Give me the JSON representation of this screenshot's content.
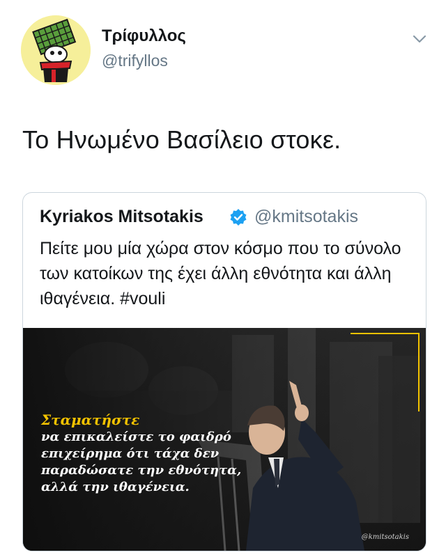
{
  "tweet": {
    "author": {
      "display_name": "Τρίφυλλος",
      "handle": "@trifyllos",
      "avatar_icon": "cartoon-character-avatar-icon"
    },
    "menu_icon": "chevron-down-icon",
    "text": "Το Ηνωμένο Βασίλειο στοκε."
  },
  "quoted_tweet": {
    "author": {
      "display_name": "Kyriakos Mitsotakis",
      "handle": "@kmitsotakis",
      "verified_icon": "verified-badge-icon"
    },
    "text": "Πείτε μου μία χώρα στον κόσμο που το σύνολο των κατοίκων της έχει άλλη εθνότητα και άλλη ιθαγένεια. #vouli",
    "media": {
      "headline": "Σταματήστε",
      "caption": "να επικαλείστε το φαιδρό επιχείρημα ότι τάχα δεν παραδώσατε την εθνότητα, αλλά την ιθαγένεια.",
      "watermark": "@kmitsotakis",
      "accent_color": "#f2c200"
    }
  },
  "colors": {
    "text_primary": "#14171a",
    "text_secondary": "#657786",
    "verified_blue": "#1da1f2",
    "card_border": "#ccd6dd"
  }
}
